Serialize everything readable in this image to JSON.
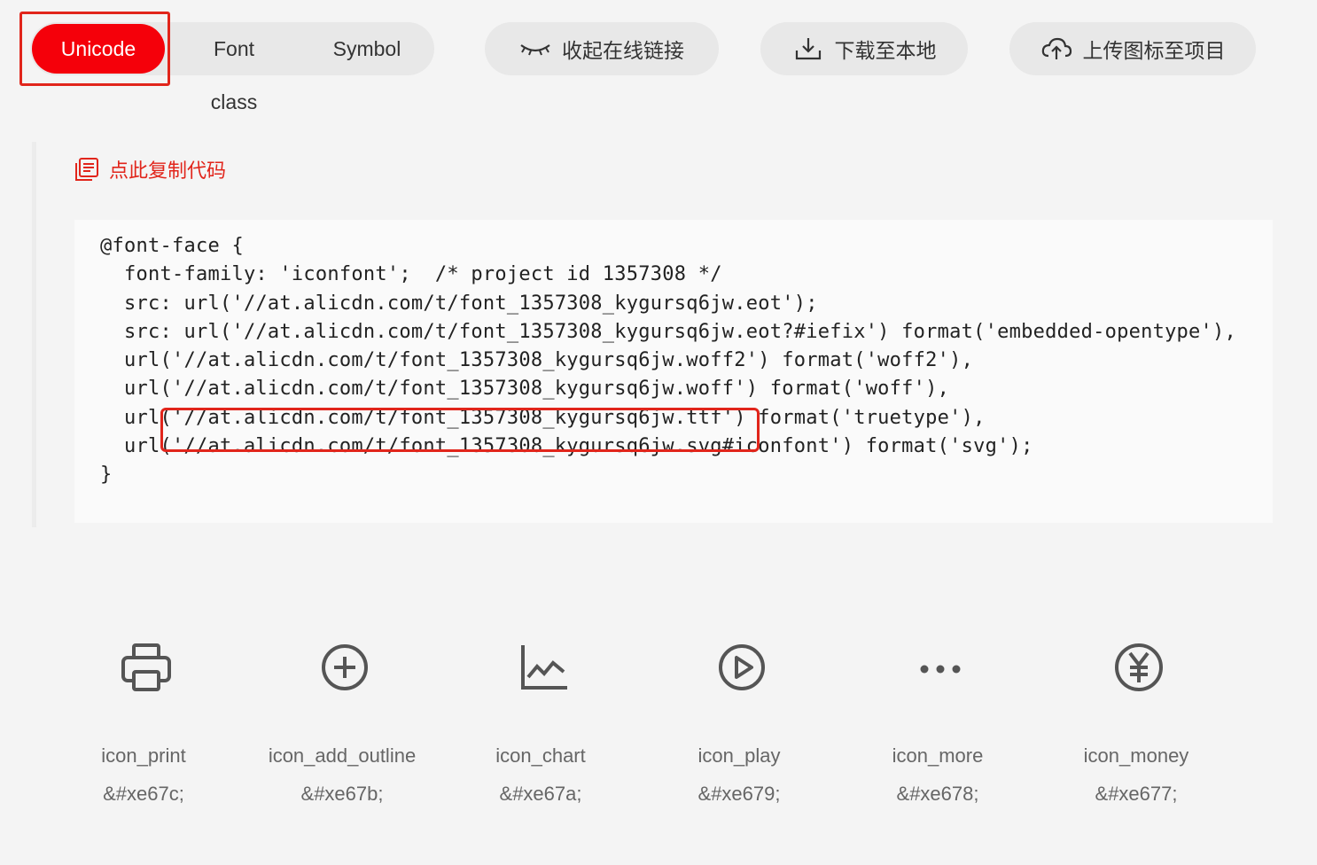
{
  "tabs": [
    "Unicode",
    "Font class",
    "Symbol"
  ],
  "actions": {
    "collapse": "收起在线链接",
    "download": "下载至本地",
    "upload": "上传图标至项目"
  },
  "copy_label": "点此复制代码",
  "code": "@font-face {\n  font-family: 'iconfont';  /* project id 1357308 */\n  src: url('//at.alicdn.com/t/font_1357308_kygursq6jw.eot');\n  src: url('//at.alicdn.com/t/font_1357308_kygursq6jw.eot?#iefix') format('embedded-opentype'),\n  url('//at.alicdn.com/t/font_1357308_kygursq6jw.woff2') format('woff2'),\n  url('//at.alicdn.com/t/font_1357308_kygursq6jw.woff') format('woff'),\n  url('//at.alicdn.com/t/font_1357308_kygursq6jw.ttf') format('truetype'),\n  url('//at.alicdn.com/t/font_1357308_kygursq6jw.svg#iconfont') format('svg');\n}",
  "icons": [
    {
      "name": "icon_print",
      "code": "&#xe67c;",
      "glyph": "printer-icon"
    },
    {
      "name": "icon_add_outline",
      "code": "&#xe67b;",
      "glyph": "add-outline-icon"
    },
    {
      "name": "icon_chart",
      "code": "&#xe67a;",
      "glyph": "chart-icon"
    },
    {
      "name": "icon_play",
      "code": "&#xe679;",
      "glyph": "play-icon"
    },
    {
      "name": "icon_more",
      "code": "&#xe678;",
      "glyph": "more-icon"
    },
    {
      "name": "icon_money",
      "code": "&#xe677;",
      "glyph": "money-icon"
    }
  ],
  "colors": {
    "accent": "#f5000a",
    "highlight": "#e1251b"
  }
}
